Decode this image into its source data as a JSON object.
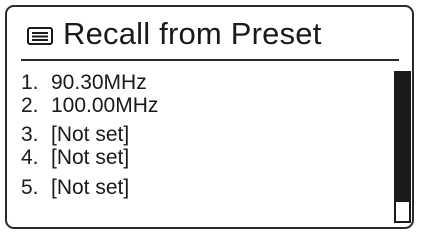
{
  "header": {
    "title": "Recall from Preset",
    "icon": "list-icon"
  },
  "presets": [
    {
      "number": "1.",
      "value": "90.30MHz"
    },
    {
      "number": "2.",
      "value": "100.00MHz"
    },
    {
      "number": "3.",
      "value": "[Not set]"
    },
    {
      "number": "4.",
      "value": "[Not set]"
    },
    {
      "number": "5.",
      "value": "[Not set]"
    }
  ],
  "scrollbar": {
    "fill_fraction": 0.87
  },
  "colors": {
    "foreground": "#1a1a1a",
    "background": "#ffffff"
  }
}
